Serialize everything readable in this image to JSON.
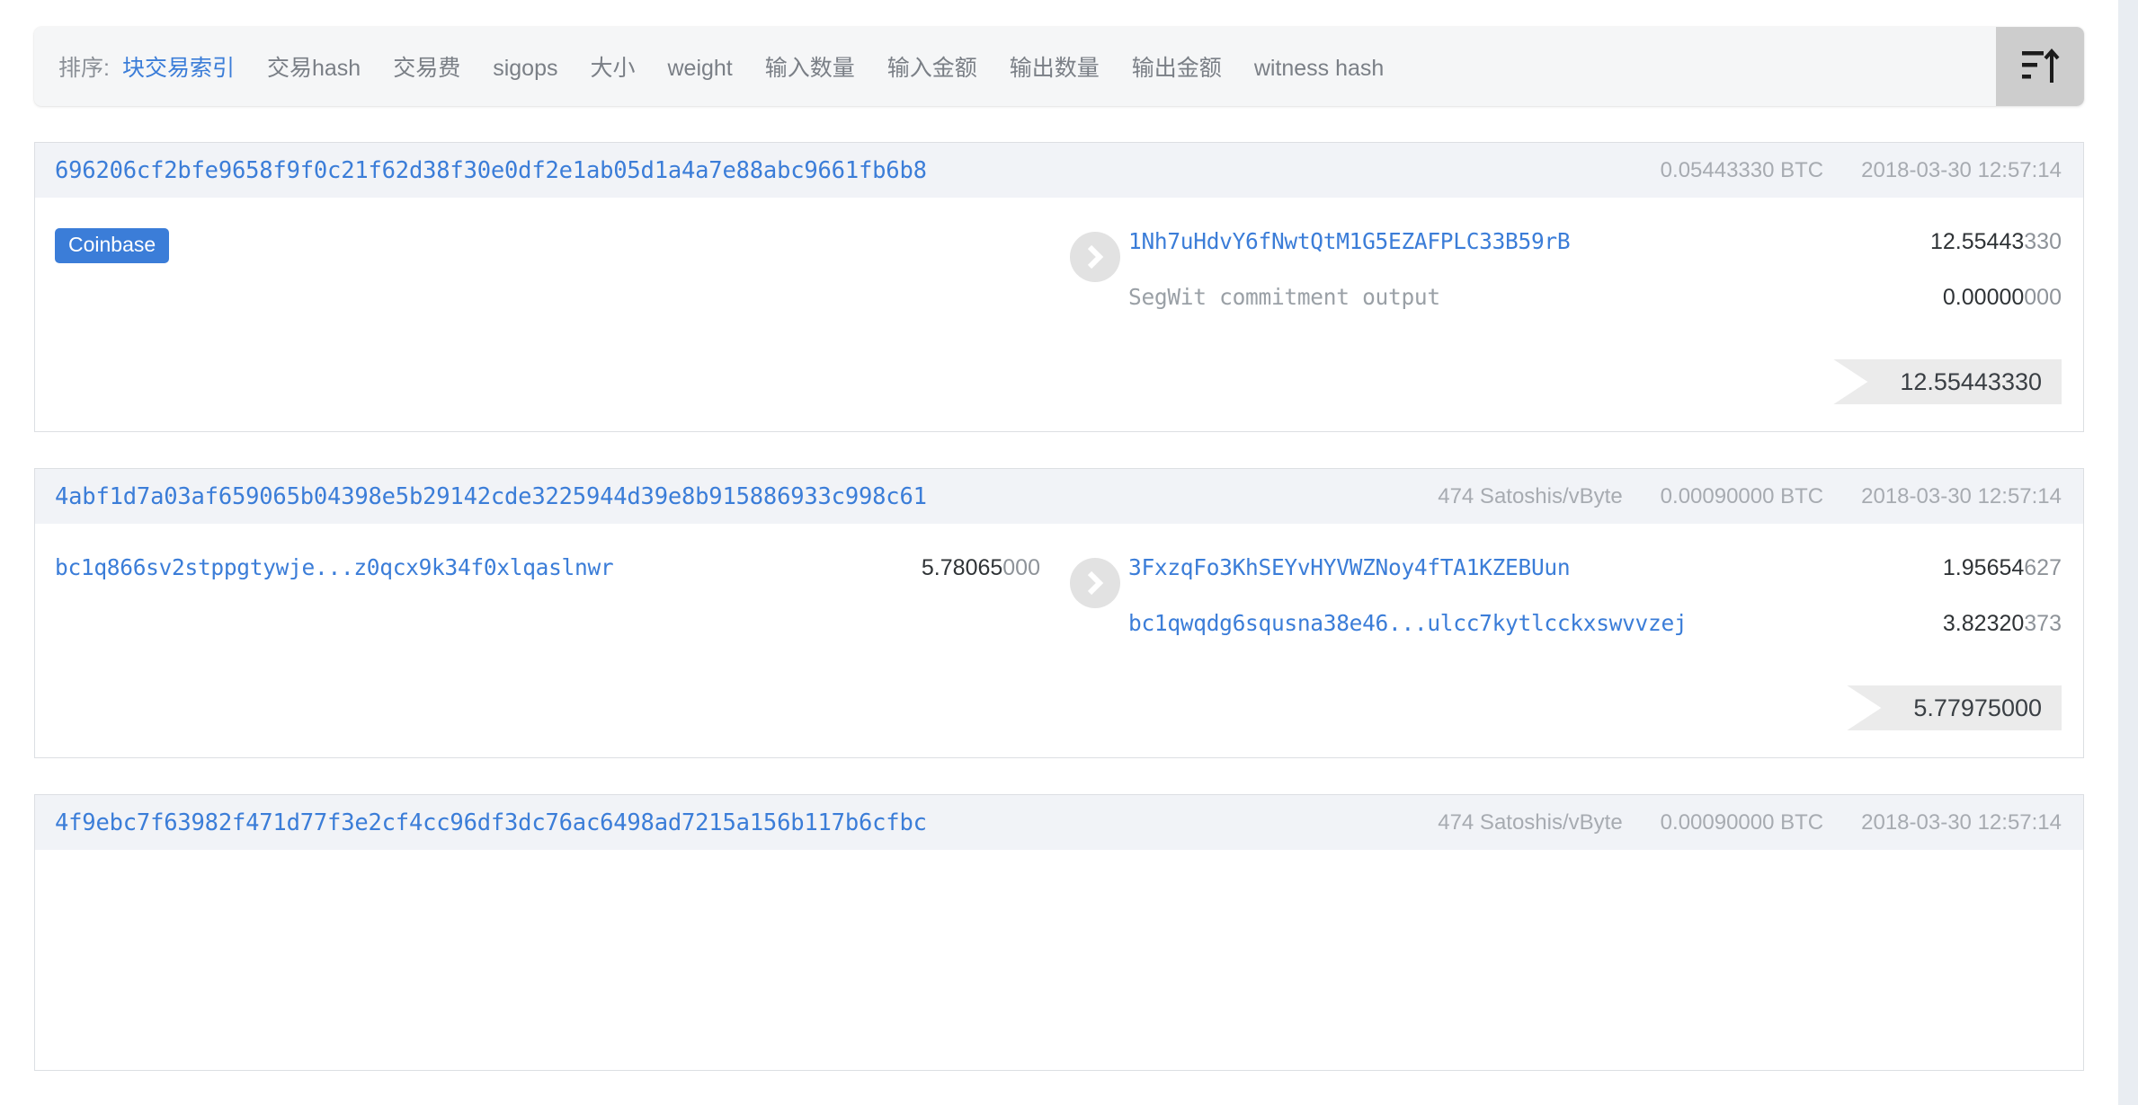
{
  "toolbar": {
    "sort_label": "排序:",
    "options": [
      {
        "label": "块交易索引",
        "active": true
      },
      {
        "label": "交易hash",
        "active": false
      },
      {
        "label": "交易费",
        "active": false
      },
      {
        "label": "sigops",
        "active": false
      },
      {
        "label": "大小",
        "active": false
      },
      {
        "label": "weight",
        "active": false
      },
      {
        "label": "输入数量",
        "active": false
      },
      {
        "label": "输入金额",
        "active": false
      },
      {
        "label": "输出数量",
        "active": false
      },
      {
        "label": "输出金额",
        "active": false
      },
      {
        "label": "witness hash",
        "active": false
      }
    ],
    "sort_direction_icon": "sort-ascending-icon",
    "accent_color": "#3b7dd8",
    "button_bg": "#cdcdcd"
  },
  "transactions": [
    {
      "hash": "696206cf2bfe9658f9f0c21f62d38f30e0df2e1ab05d1a4a7e88abc9661fb6b8",
      "feerate": "",
      "fee": "0.05443330 BTC",
      "time": "2018-03-30 12:57:14",
      "is_coinbase": true,
      "coinbase_label": "Coinbase",
      "inputs": [],
      "outputs": [
        {
          "address": "1Nh7uHdvY6fNwtQtM1G5EZAFPLC33B59rB",
          "muted": false,
          "amount_lead": "12.55443",
          "amount_tail": "330"
        },
        {
          "address": "SegWit commitment output",
          "muted": true,
          "amount_lead": "0.00000",
          "amount_tail": "000"
        }
      ],
      "total_lead": "12.55443",
      "total_tail": "330"
    },
    {
      "hash": "4abf1d7a03af659065b04398e5b29142cde3225944d39e8b915886933c998c61",
      "feerate": "474 Satoshis/vByte",
      "fee": "0.00090000 BTC",
      "time": "2018-03-30 12:57:14",
      "is_coinbase": false,
      "coinbase_label": "",
      "inputs": [
        {
          "address": "bc1q866sv2stppgtywje...z0qcx9k34f0xlqaslnwr",
          "muted": false,
          "amount_lead": "5.78065",
          "amount_tail": "000"
        }
      ],
      "outputs": [
        {
          "address": "3FxzqFo3KhSEYvHYVWZNoy4fTA1KZEBUun",
          "muted": false,
          "amount_lead": "1.95654",
          "amount_tail": "627"
        },
        {
          "address": "bc1qwqdg6squsna38e46...ulcc7kytlcckxswvvzej",
          "muted": false,
          "amount_lead": "3.82320",
          "amount_tail": "373"
        }
      ],
      "total_lead": "5.77975",
      "total_tail": "000"
    },
    {
      "hash": "4f9ebc7f63982f471d77f3e2cf4cc96df3dc76ac6498ad7215a156b117b6cfbc",
      "feerate": "474 Satoshis/vByte",
      "fee": "0.00090000 BTC",
      "time": "2018-03-30 12:57:14",
      "is_coinbase": false,
      "coinbase_label": "",
      "inputs": [],
      "outputs": [],
      "total_lead": "",
      "total_tail": ""
    }
  ]
}
